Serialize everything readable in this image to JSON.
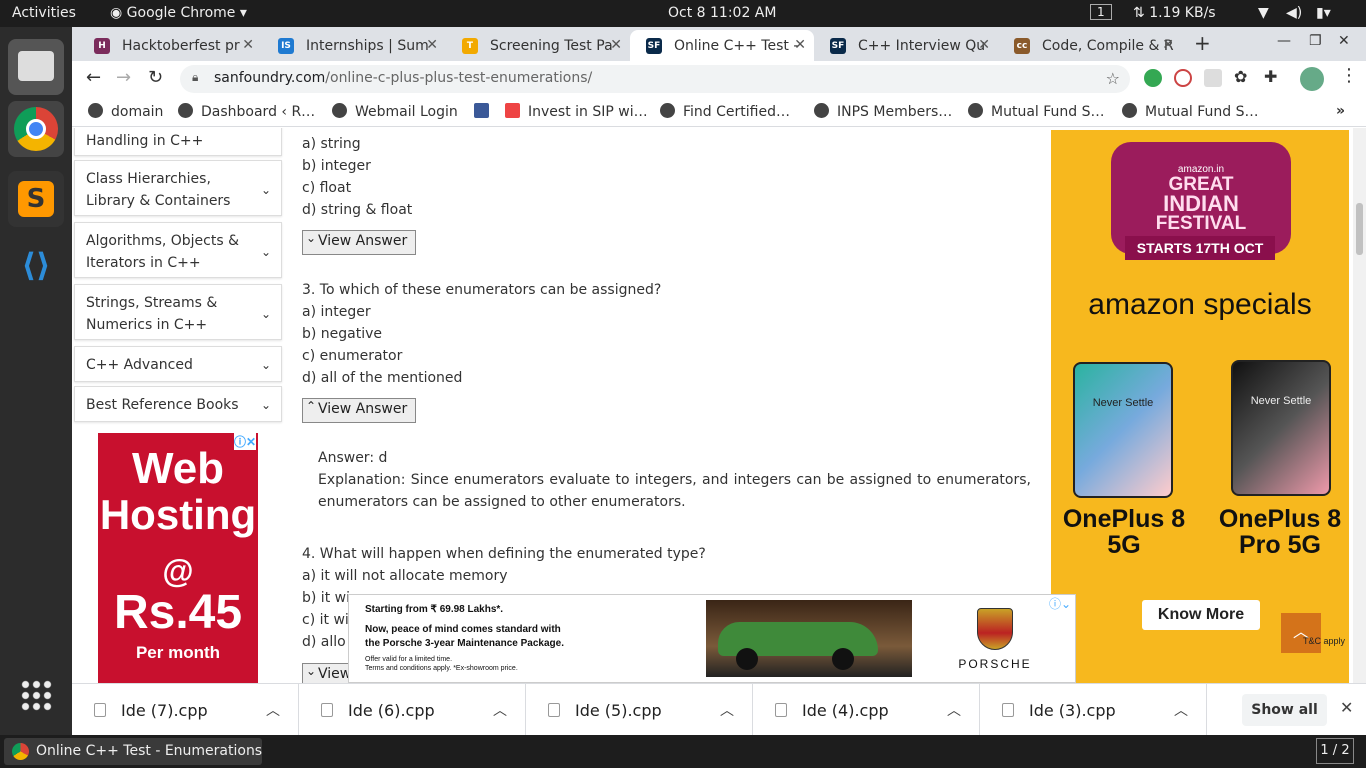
{
  "system": {
    "activities": "Activities",
    "app": "Google Chrome",
    "clock": "Oct 8  11:02 AM",
    "workspace": "1",
    "net": "1.19 KB/s"
  },
  "tabs": [
    {
      "title": "Hacktoberfest pr",
      "color": "#7b2c5c",
      "fav": "H"
    },
    {
      "title": "Internships | Sum",
      "color": "#1f7ad1",
      "fav": "IS"
    },
    {
      "title": "Screening Test Pa",
      "color": "#f2a900",
      "fav": "T"
    },
    {
      "title": "Online C++ Test -",
      "color": "#0a2a4a",
      "fav": "SF"
    },
    {
      "title": "C++ Interview Qu",
      "color": "#0a2a4a",
      "fav": "SF"
    },
    {
      "title": "Code, Compile & R",
      "color": "#8a5a2b",
      "fav": "cc"
    }
  ],
  "url": {
    "domain": "sanfoundry.com",
    "path": "/online-c-plus-plus-test-enumerations/"
  },
  "bookmarks": [
    "domain",
    "Dashboard ‹ R…",
    "Webmail Login",
    "Invest in SIP wi…",
    "Find Certified…",
    "INPS Members…",
    "Mutual Fund S…",
    "Mutual Fund S…"
  ],
  "sidebar": [
    "Handling in C++",
    "Class Hierarchies, Library & Containers",
    "Algorithms, Objects & Iterators in C++",
    "Strings, Streams & Numerics in C++",
    "C++ Advanced",
    "Best Reference Books"
  ],
  "left_ad": {
    "l1": "Web",
    "l2": "Hosting",
    "l3": "@",
    "l4": "Rs.45",
    "l5": "Per month"
  },
  "q2_options": [
    "a) string",
    "b) integer",
    "c) float",
    "d) string & float"
  ],
  "view_answer": "View Answer",
  "q3": {
    "question": "3. To which of these enumerators can be assigned?",
    "options": [
      "a) integer",
      "b) negative",
      "c) enumerator",
      "d) all of the mentioned"
    ],
    "answer": "Answer: d",
    "explanation": "Explanation: Since enumerators evaluate to integers, and integers can be assigned to enumerators, enumerators can be assigned to other enumerators."
  },
  "q4": {
    "question": "4. What will happen when defining the enumerated type?",
    "options": [
      "a) it will not allocate memory",
      "b) it wi",
      "c) it wi",
      "d) allo"
    ],
    "view": "View"
  },
  "right_ad": {
    "brand": "amazon.in",
    "l1": "GREAT",
    "l2": "INDIAN",
    "l3": "FESTIVAL",
    "starts": "STARTS 17TH OCT",
    "specials": "amazon specials",
    "phone1": "OnePlus 8 5G",
    "phone2": "OnePlus 8 Pro 5G",
    "phone_text": "Never Settle",
    "cta": "Know More",
    "tc": "T&C apply"
  },
  "bottom_ad": {
    "l1": "Starting from ₹ 69.98 Lakhs*.",
    "l2": "Now, peace of mind comes standard with",
    "l3": "the Porsche 3-year Maintenance Package.",
    "l4": "Offer valid for a limited time.",
    "l5": "Terms and conditions apply. *Ex-showroom price.",
    "brand": "PORSCHE"
  },
  "downloads": [
    "Ide (7).cpp",
    "Ide (6).cpp",
    "Ide (5).cpp",
    "Ide (4).cpp",
    "Ide (3).cpp"
  ],
  "show_all": "Show all",
  "taskbar": {
    "window": "Online C++ Test - Enumerations - S…",
    "pager": "1 / 2"
  }
}
